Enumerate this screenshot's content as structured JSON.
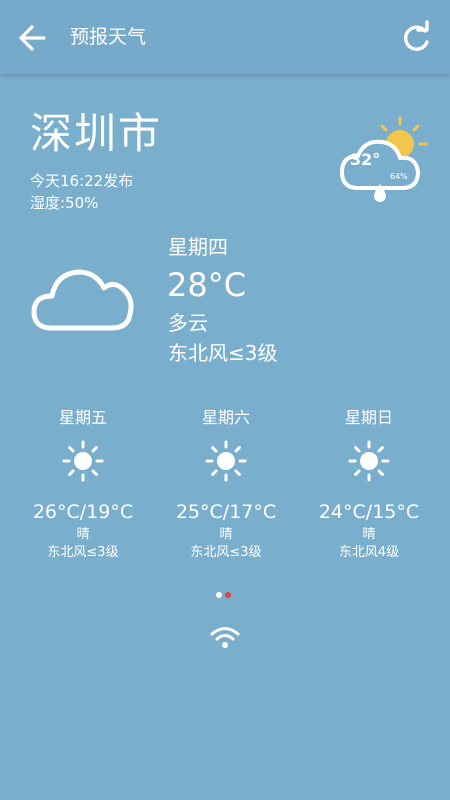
{
  "toolbar": {
    "back_icon": "arrow-left-icon",
    "title": "预报天气",
    "refresh_icon": "refresh-icon"
  },
  "current": {
    "city": "深圳市",
    "publish_time": "今天16:22发布",
    "humidity": "湿度:50%",
    "widget": {
      "temp": "32°",
      "humidity": "64%",
      "icon": "sun-cloud-rain-icon"
    }
  },
  "today": {
    "day": "星期四",
    "temp": "28°C",
    "condition": "多云",
    "wind": "东北风≤3级",
    "icon": "cloud-icon"
  },
  "forecast": [
    {
      "day": "星期五",
      "temp": "26°C/19°C",
      "condition": "晴",
      "wind": "东北风≤3级",
      "icon": "sun-icon"
    },
    {
      "day": "星期六",
      "temp": "25°C/17°C",
      "condition": "晴",
      "wind": "东北风≤3级",
      "icon": "sun-icon"
    },
    {
      "day": "星期日",
      "temp": "24°C/15°C",
      "condition": "晴",
      "wind": "东北风4级",
      "icon": "sun-icon"
    }
  ],
  "pager": {
    "count": 2,
    "active_index": 1
  },
  "colors": {
    "background": "#7aaecd",
    "toolbar": "#76aaca",
    "sun": "#f2c54b",
    "dot_active": "#e0453c",
    "dot_inactive": "#ffffff"
  },
  "status": {
    "network_icon": "wifi-icon"
  }
}
